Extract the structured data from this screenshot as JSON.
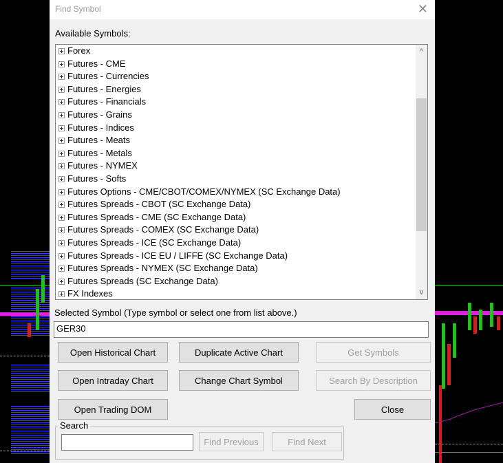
{
  "dialog": {
    "title": "Find Symbol",
    "close_glyph": "✕",
    "available_label": "Available Symbols:",
    "selected_label": "Selected Symbol (Type symbol or select one from list above.)",
    "selected_value": "GER30",
    "search_group_label": "Search",
    "search_value": ""
  },
  "symbols": [
    "Forex",
    "Futures - CME",
    "Futures - Currencies",
    "Futures - Energies",
    "Futures - Financials",
    "Futures - Grains",
    "Futures - Indices",
    "Futures - Meats",
    "Futures - Metals",
    "Futures - NYMEX",
    "Futures - Softs",
    "Futures Options - CME/CBOT/COMEX/NYMEX (SC Exchange Data)",
    "Futures Spreads - CBOT (SC Exchange Data)",
    "Futures Spreads - CME (SC Exchange Data)",
    "Futures Spreads - COMEX (SC Exchange Data)",
    "Futures Spreads - ICE (SC Exchange Data)",
    "Futures Spreads - ICE EU / LIFFE (SC Exchange Data)",
    "Futures Spreads - NYMEX (SC Exchange Data)",
    "Futures Spreads (SC Exchange Data)",
    "FX Indexes"
  ],
  "scroll": {
    "up": "^",
    "down": "v"
  },
  "buttons": {
    "open_historical": "Open Historical Chart",
    "duplicate_active": "Duplicate Active Chart",
    "get_symbols": "Get Symbols",
    "open_intraday": "Open Intraday Chart",
    "change_symbol": "Change Chart Symbol",
    "search_description": "Search By Description",
    "open_dom": "Open Trading DOM",
    "close": "Close",
    "find_previous": "Find Previous",
    "find_next": "Find Next"
  }
}
